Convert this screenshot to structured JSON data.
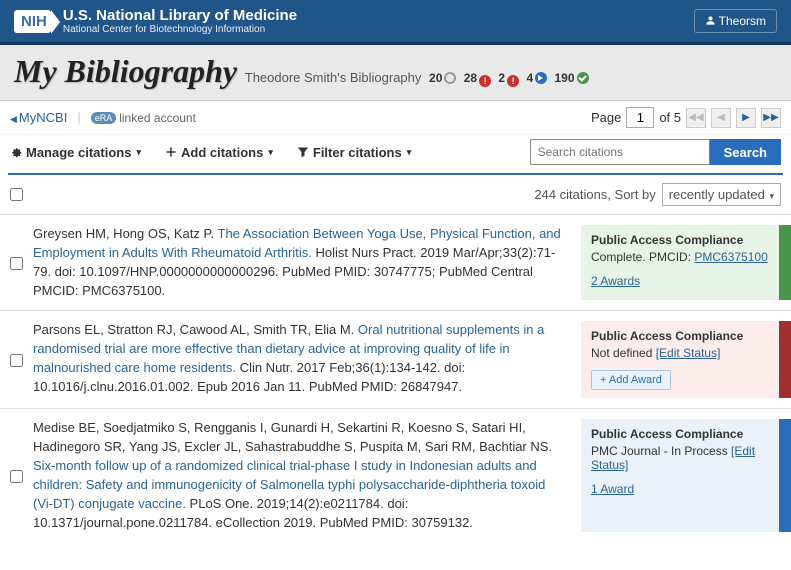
{
  "header": {
    "org": "U.S. National Library of Medicine",
    "sub": "National Center for Biotechnology Information",
    "logo": "NIH",
    "user": "Theorsm"
  },
  "page": {
    "title": "My Bibliography",
    "subtitle": "Theodore Smith's Bibliography",
    "stats": [
      {
        "n": "20",
        "cls": "ic-gray"
      },
      {
        "n": "28",
        "cls": "ic-red"
      },
      {
        "n": "2",
        "cls": "ic-red"
      },
      {
        "n": "4",
        "cls": "ic-blue"
      },
      {
        "n": "190",
        "cls": "ic-green"
      }
    ]
  },
  "nav": {
    "back": "MyNCBI",
    "linked": "linked account",
    "page_label": "Page",
    "page_current": "1",
    "page_total": "of 5"
  },
  "actions": {
    "manage": "Manage citations",
    "add": "Add citations",
    "filter": "Filter citations"
  },
  "search": {
    "placeholder": "Search citations",
    "button": "Search"
  },
  "sort": {
    "count": "244 citations, Sort by",
    "selected": "recently updated"
  },
  "compliance_label": "Public Access Compliance",
  "citations": [
    {
      "authors": "Greysen HM, Hong OS, Katz P. ",
      "title": "The Association Between Yoga Use, Physical Function, and Employment in Adults With Rheumatoid Arthritis.",
      "rest": " Holist Nurs Pract. 2019 Mar/Apr;33(2):71-79. doi: 10.1097/HNP.0000000000000296. PubMed PMID: 30747775; PubMed Central PMCID: PMC6375100.",
      "comp": {
        "cls": "comp-green",
        "status": "Complete. PMCID: ",
        "link": "PMC6375100",
        "award": "2 Awards"
      }
    },
    {
      "authors": "Parsons EL, Stratton RJ, Cawood AL, Smith TR, Elia M. ",
      "title": "Oral nutritional supplements in a randomised trial are more effective than dietary advice at improving quality of life in malnourished care home residents.",
      "rest": " Clin Nutr. 2017 Feb;36(1):134-142. doi: 10.1016/j.clnu.2016.01.002. Epub 2016 Jan 11. PubMed PMID: 26847947.",
      "comp": {
        "cls": "comp-red",
        "status": "Not defined ",
        "edit": "[Edit Status]",
        "add_award": "+ Add Award"
      }
    },
    {
      "authors": "Medise BE, Soedjatmiko S, Rengganis I, Gunardi H, Sekartini R, Koesno S, Satari HI, Hadinegoro SR, Yang JS, Excler JL, Sahastrabuddhe S, Puspita M, Sari RM, Bachtiar NS. ",
      "title": "Six-month follow up of a randomized clinical trial-phase I study in Indonesian adults and children: Safety and immunogenicity of Salmonella typhi polysaccharide-diphtheria toxoid (Vi-DT) conjugate vaccine.",
      "rest": " PLoS One. 2019;14(2):e0211784. doi: 10.1371/journal.pone.0211784. eCollection 2019. PubMed PMID: 30759132.",
      "comp": {
        "cls": "comp-blue",
        "status": "PMC Journal - In Process ",
        "edit": "[Edit Status]",
        "award": "1 Award"
      }
    }
  ]
}
